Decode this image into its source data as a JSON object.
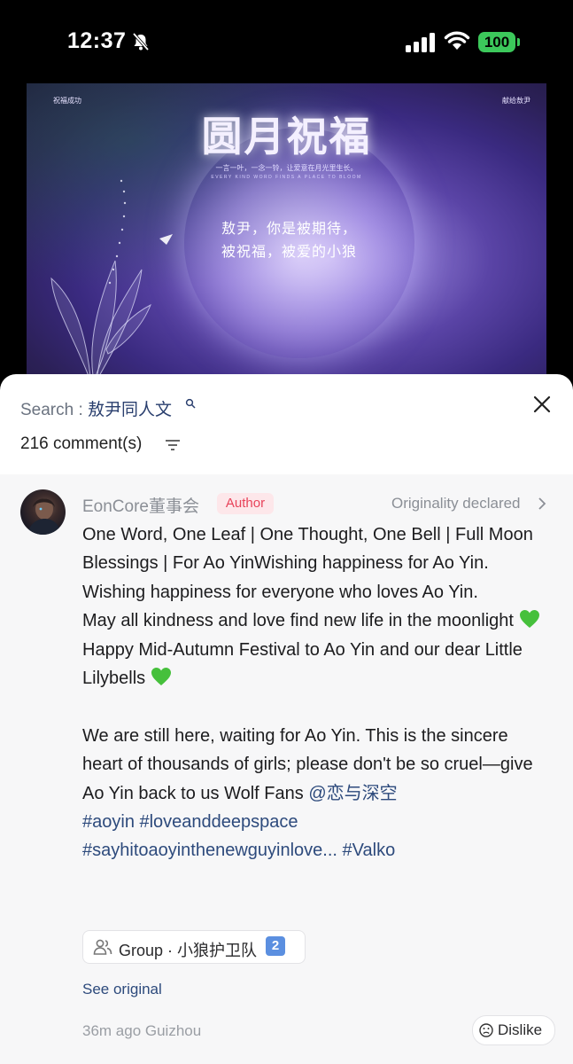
{
  "status_bar": {
    "time": "12:37",
    "battery": "100",
    "icons": [
      "bell-muted-icon",
      "cellular-signal-icon",
      "wifi-icon",
      "battery-icon"
    ],
    "battery_color": "#3cc85b"
  },
  "banner": {
    "corner_left": "祝福成功",
    "corner_right": "献给敖尹",
    "title": "圆月祝福",
    "subtitle": "一言一叶，一念一铃，让爱意在月光里生长。",
    "subtitle_small": "EVERY KIND WORD FINDS A PLACE TO BLOOM",
    "line1": "敖尹，你是被期待，",
    "line2": "被祝福，被爱的小狼"
  },
  "sheet": {
    "search_prefix": "Search : ",
    "search_term": "敖尹同人文",
    "comment_count": "216 comment(s)"
  },
  "comment": {
    "username": "EonCore董事会",
    "badge": "Author",
    "originality": "Originality declared",
    "p1": "One Word, One Leaf | One Thought, One Bell | Full Moon Blessings | For Ao YinWishing happiness for Ao Yin.",
    "p2": "Wishing happiness for everyone who loves Ao Yin.",
    "p3": "May all kindness and love find new life in the moonlight",
    "p4": "Happy Mid-Autumn Festival to Ao Yin and our dear Little Lilybells",
    "p5": "We are still here, waiting for Ao Yin. This is the sincere heart of thousands of girls; please don't be so cruel—give Ao Yin back to us Wolf Fans",
    "mention": "@恋与深空",
    "hashtags_line1": "#aoyin #loveanddeepspace",
    "hashtags_line2": "#sayhitoaoyinthenewguyinlove... #Valko",
    "group_label": "Group · 小狼护卫队",
    "group_number": "2",
    "see_original": "See original",
    "meta": "36m ago Guizhou",
    "dislike": "Dislike",
    "link_color": "#2d4a7c",
    "badge_color": "#e8435a"
  }
}
